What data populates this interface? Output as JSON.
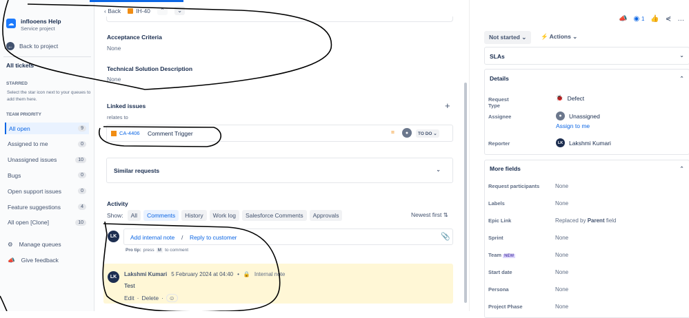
{
  "sidebar": {
    "project_name": "inflooens Help",
    "project_type": "Service project",
    "back": "Back to project",
    "all_tickets": "All tickets",
    "starred_heading": "STARRED",
    "starred_hint": "Select the star icon next to your queues to add them here.",
    "team_heading": "TEAM PRIORITY",
    "queues": [
      {
        "label": "All open",
        "count": "9"
      },
      {
        "label": "Assigned to me",
        "count": "0"
      },
      {
        "label": "Unassigned issues",
        "count": "10"
      },
      {
        "label": "Bugs",
        "count": "0"
      },
      {
        "label": "Open support issues",
        "count": "0"
      },
      {
        "label": "Feature suggestions",
        "count": "4"
      },
      {
        "label": "All open [Clone]",
        "count": "10"
      }
    ],
    "manage": "Manage queues",
    "feedback": "Give feedback"
  },
  "main": {
    "back": "Back",
    "issue_key": "IH-40",
    "acceptance": {
      "label": "Acceptance Criteria",
      "value": "None"
    },
    "technical": {
      "label": "Technical Solution Description",
      "value": "None"
    },
    "linked": {
      "label": "Linked issues",
      "relation": "relates to",
      "key": "CA-4406",
      "summary": "Comment Trigger",
      "status": "TO DO"
    },
    "similar": "Similar requests",
    "activity": {
      "label": "Activity",
      "show": "Show:",
      "filters": [
        "All",
        "Comments",
        "History",
        "Work log",
        "Salesforce Comments",
        "Approvals"
      ],
      "active": "Comments",
      "sort": "Newest first"
    },
    "composer": {
      "initials": "LK",
      "internal": "Add internal note",
      "sep": "/",
      "reply": "Reply to customer",
      "tip_bold": "Pro tip:",
      "tip_pre": "press",
      "tip_key": "M",
      "tip_post": "to comment"
    },
    "comment": {
      "initials": "LK",
      "author": "Lakshmi Kumari",
      "date": "5 February 2024 at 04:40",
      "visibility": "Internal note",
      "body": "Test",
      "edit": "Edit",
      "delete": "Delete"
    }
  },
  "right": {
    "watch_count": "1",
    "status": "Not started",
    "actions": "Actions",
    "slas": "SLAs",
    "details": "Details",
    "fields": [
      {
        "label": "Request Type",
        "value": "Defect"
      },
      {
        "label": "Assignee",
        "value": "Unassigned",
        "action": "Assign to me"
      },
      {
        "label": "Reporter",
        "value": "Lakshmi Kumari",
        "initials": "LK"
      }
    ],
    "more": "More fields",
    "more_fields": [
      {
        "label": "Request participants",
        "value": "None"
      },
      {
        "label": "Labels",
        "value": "None"
      },
      {
        "label": "Epic Link",
        "value": "Replaced by Parent field"
      },
      {
        "label": "Sprint",
        "value": "None"
      },
      {
        "label": "Team",
        "badge": "NEW",
        "value": "None"
      },
      {
        "label": "Start date",
        "value": "None"
      },
      {
        "label": "Persona",
        "value": "None"
      },
      {
        "label": "Project Phase",
        "value": "None"
      }
    ]
  },
  "colors": {
    "accent": "#0c66e4",
    "comment_bg": "#fff7d6",
    "issue_orange": "#f18d13"
  }
}
